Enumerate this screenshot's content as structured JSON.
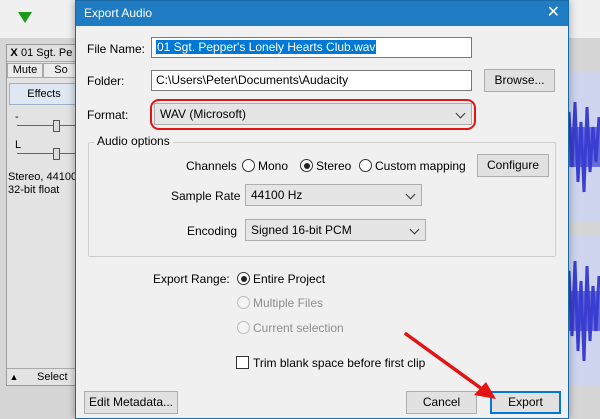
{
  "background": {
    "track": {
      "close_label": "X",
      "name": "01 Sgt. Pe",
      "mute_label": "Mute",
      "solo_label": "So",
      "effects_label": "Effects",
      "gain_label": "-",
      "pan_label": "L",
      "info_line1": "Stereo, 44100",
      "info_line2": "32-bit float",
      "select_label": "Select"
    },
    "colors": {
      "waveform": "#3a3fd0",
      "play_button": "#1a9c1a"
    }
  },
  "dialog": {
    "title": "Export Audio",
    "close_icon": "close-icon",
    "file_name_label": "File Name:",
    "file_name_value": "01 Sgt. Pepper's Lonely Hearts Club.wav",
    "folder_label": "Folder:",
    "folder_value": "C:\\Users\\Peter\\Documents\\Audacity",
    "browse_label": "Browse...",
    "format_label": "Format:",
    "format_value": "WAV (Microsoft)",
    "audio_options": {
      "legend": "Audio options",
      "channels_label": "Channels",
      "channel_options": [
        "Mono",
        "Stereo",
        "Custom mapping"
      ],
      "channel_selected": "Stereo",
      "configure_label": "Configure",
      "sample_rate_label": "Sample Rate",
      "sample_rate_value": "44100 Hz",
      "encoding_label": "Encoding",
      "encoding_value": "Signed 16-bit PCM"
    },
    "export_range": {
      "label": "Export Range:",
      "options": [
        "Entire Project",
        "Multiple Files",
        "Current selection"
      ],
      "selected": "Entire Project"
    },
    "trim_label": "Trim blank space before first clip",
    "trim_checked": false,
    "edit_metadata_label": "Edit Metadata...",
    "cancel_label": "Cancel",
    "export_label": "Export",
    "colors": {
      "title_bar": "#1f7cc3",
      "highlight_ring": "#e21414",
      "arrow": "#e21414",
      "accent": "#0078d7"
    }
  }
}
